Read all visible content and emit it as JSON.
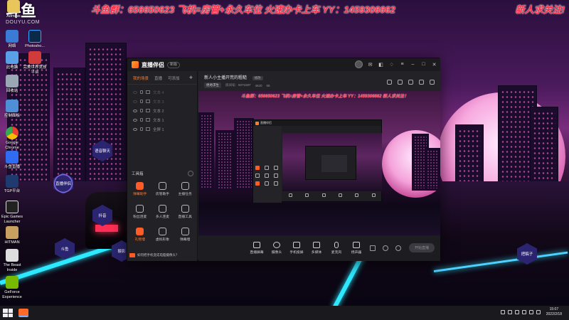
{
  "banner": {
    "left": "斗鱼群：656650623 飞机=房管+永久车位 火速办卡上车 YY：1459306662",
    "right": "新人求关注!"
  },
  "logo": {
    "mark": "斗鱼",
    "site": "DOUYU.COM"
  },
  "desktop_icons": [
    {
      "label": "Adminis"
    },
    {
      "label": "网络"
    },
    {
      "label": "Photosho..."
    },
    {
      "label": "此电脑"
    },
    {
      "label": "完美世界竞技平台"
    },
    {
      "label": "回收站"
    },
    {
      "label": "控制面板"
    },
    {
      "label": "Google Chrome"
    },
    {
      "label": "斗鱼直播"
    },
    {
      "label": "TGP平台"
    },
    {
      "label": "Epic Games Launcher"
    },
    {
      "label": "HITMAN"
    },
    {
      "label": "The Beast Inside"
    },
    {
      "label": "GeForce Experience"
    }
  ],
  "hex_buttons": {
    "room": "语音聊天",
    "live": "直播伴侣",
    "room2": "抖音",
    "stats": "斗鱼",
    "cam": "摄影",
    "right": "把稿子"
  },
  "app": {
    "name": "直播伴侣",
    "version": "新版",
    "tabs": [
      "我的场景",
      "直播",
      "可添加"
    ],
    "add_label": "+",
    "scenes": [
      {
        "name": "文本 4",
        "dim": true
      },
      {
        "name": "文本 3",
        "dim": true
      },
      {
        "name": "文本 2",
        "dim": false
      },
      {
        "name": "文本 1",
        "dim": false
      },
      {
        "name": "全屏 1",
        "dim": false
      }
    ],
    "tools_title": "工具箱",
    "tools": [
      {
        "label": "弹幕助手",
        "hot": true
      },
      {
        "label": "房管助手",
        "hot": false
      },
      {
        "label": "主播任务",
        "hot": false
      },
      {
        "label": "粉丝连麦",
        "hot": false
      },
      {
        "label": "多人连麦",
        "hot": false
      },
      {
        "label": "直播工具",
        "hot": false
      },
      {
        "label": "礼物墙",
        "hot": true
      },
      {
        "label": "虚拟形象",
        "hot": false
      },
      {
        "label": "弹幕墙",
        "hot": false
      }
    ],
    "tip": "如何把手机变成电脑摄像头？",
    "room_title": "新人小主播开荒的粗糙",
    "edit_label": "修改",
    "meta": {
      "category": "绝地求生",
      "room_id": "房间号：5071587",
      "hot": "4620",
      "fans": "68"
    },
    "preview_text": "斗鱼群：656650623 飞机=房管+永久车位 火速办卡上车 YY：1459306662   新人求关注！",
    "controls": [
      "直播屏幕",
      "摄像头",
      "手机投屏",
      "多媒体",
      "麦克风",
      "扬声器"
    ],
    "go_live": "开始直播"
  },
  "taskbar": {
    "time": "15:07",
    "date": "2022/2/18"
  },
  "colors": {
    "accent": "#ff6a2a",
    "banner_text": "#ff2a44",
    "neon": "#2ce9ff"
  }
}
